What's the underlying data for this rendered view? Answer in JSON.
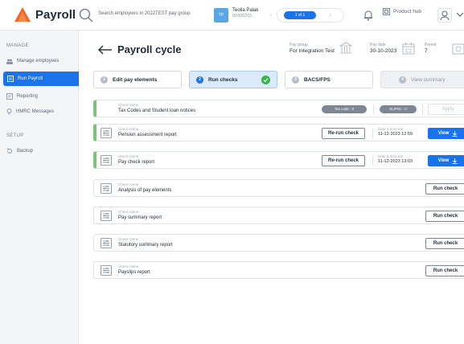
{
  "app": {
    "title": "Payroll",
    "accent": "#1a73e8",
    "logo_color": "#f26522"
  },
  "topbar": {
    "search_text": "Search employees in 2022TEST pay group",
    "employee": {
      "initials": "TP",
      "name": "Teolia Palak",
      "id": "01000201"
    },
    "pager": "1 of 1",
    "product_hub": "Product hub"
  },
  "sidebar": {
    "manage_heading": "MANAGE",
    "items": [
      {
        "label": "Manage employees",
        "icon": "people-icon"
      },
      {
        "label": "Run Payroll",
        "icon": "payroll-icon",
        "active": true
      },
      {
        "label": "Reporting",
        "icon": "report-icon"
      },
      {
        "label": "HMRC Messages",
        "icon": "bulb-icon"
      }
    ],
    "setup_heading": "SETUP",
    "setup_items": [
      {
        "label": "Backup",
        "icon": "backup-icon"
      }
    ]
  },
  "header": {
    "title": "Payroll cycle",
    "pay_group_label": "Pay group",
    "pay_group": "For Integration Test",
    "pay_date_label": "Pay date",
    "pay_date": "30-10-2023",
    "period_label": "Period",
    "period": "7"
  },
  "steps": [
    {
      "num": "1",
      "label": "Edit pay elements"
    },
    {
      "num": "2",
      "label": "Run checks",
      "current": true,
      "done": true
    },
    {
      "num": "3",
      "label": "BACS/FPS"
    },
    {
      "num": "4",
      "label": "View summary",
      "disabled": true
    }
  ],
  "checks": {
    "check_name_label": "Check name",
    "date_time_label": "Date & time ran",
    "rows": [
      {
        "name": "Tax Codes and Student loan notices",
        "tax_code_pill": "Tax code : 0",
        "slpgl_pill": "SL/PGL : 0",
        "apply_label": "Apply"
      },
      {
        "name": "Pension assessment report",
        "rerun_label": "Re-run check",
        "date": "11-12-2023 12:59",
        "view_label": "View"
      },
      {
        "name": "Pay check report",
        "rerun_label": "Re-run check",
        "date": "11-12-2023 13:03",
        "view_label": "View"
      },
      {
        "name": "Analysis of pay elements",
        "run_label": "Run check"
      },
      {
        "name": "Pay summary report",
        "run_label": "Run check"
      },
      {
        "name": "Statutory summary report",
        "run_label": "Run check"
      },
      {
        "name": "Payslips report",
        "run_label": "Run check"
      }
    ]
  }
}
